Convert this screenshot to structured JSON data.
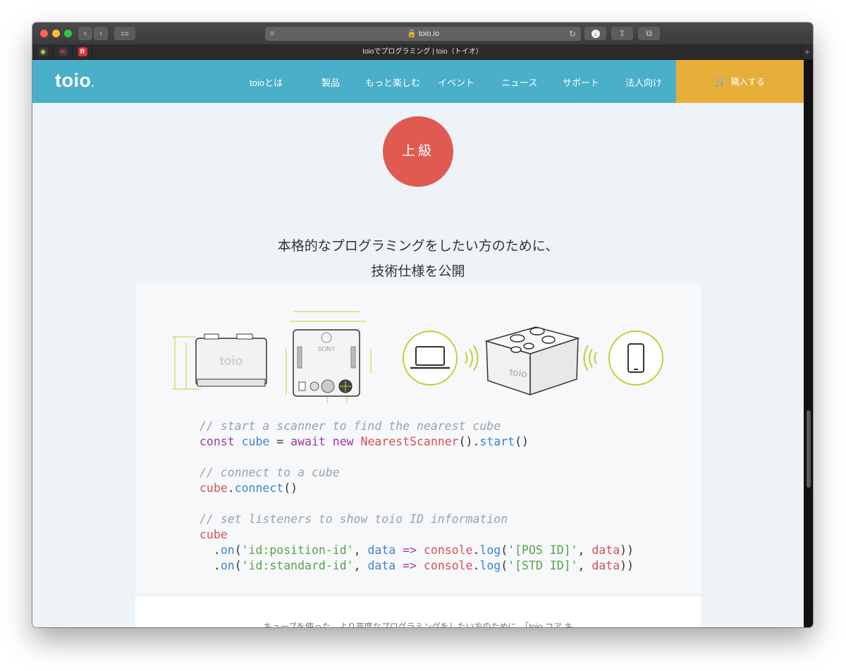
{
  "browser": {
    "url": "toio.io",
    "tab_title": "toioでプログラミング | toio（トイオ）",
    "back_icon": "chevron-left-icon",
    "forward_icon": "chevron-right-icon"
  },
  "header": {
    "logo": "toio",
    "nav": [
      "toioとは",
      "製品",
      "もっと楽しむ",
      "イベント",
      "ニュース",
      "サポート",
      "法人向け"
    ],
    "buy_label": "購入する",
    "colors": {
      "header_bg": "#4aafc9",
      "buy_bg": "#e8ae3a"
    }
  },
  "main": {
    "level_badge": "上級",
    "headline_line1": "本格的なプログラミングをしたい方のために、",
    "headline_line2": "技術仕様を公開",
    "logo_on_cube": "toio",
    "sony_mark": "SONY",
    "teaser": "キューブを使った、より高度なプログラミングをしたい方のために、「toio コア キ"
  },
  "code": {
    "comment1": "// start a scanner to find the nearest cube",
    "l2_const": "const",
    "l2_cube": "cube",
    "l2_eq": " = ",
    "l2_await": "await",
    "l2_new": "new",
    "l2_class": "NearestScanner",
    "l2_p1": "().",
    "l2_start": "start",
    "l2_p2": "()",
    "comment2": "// connect to a cube",
    "l4_cube": "cube",
    "l4_dot": ".",
    "l4_connect": "connect",
    "l4_p": "()",
    "comment3": "// set listeners to show toio ID information",
    "l6_cube": "cube",
    "l7_dot": "  .",
    "l7_on": "on",
    "l7_p1": "(",
    "l7_str": "'id:position-id'",
    "l7_c": ", ",
    "l7_data": "data",
    "l7_arrow": " => ",
    "l7_console": "console",
    "l7_dot2": ".",
    "l7_log": "log",
    "l7_p2": "(",
    "l7_str2": "'[POS ID]'",
    "l7_c2": ", ",
    "l7_data2": "data",
    "l7_end": "))",
    "l8_dot": "  .",
    "l8_on": "on",
    "l8_p1": "(",
    "l8_str": "'id:standard-id'",
    "l8_c": ", ",
    "l8_data": "data",
    "l8_arrow": " => ",
    "l8_console": "console",
    "l8_dot2": ".",
    "l8_log": "log",
    "l8_p2": "(",
    "l8_str2": "'[STD ID]'",
    "l8_c2": ", ",
    "l8_data2": "data",
    "l8_end": "))"
  }
}
